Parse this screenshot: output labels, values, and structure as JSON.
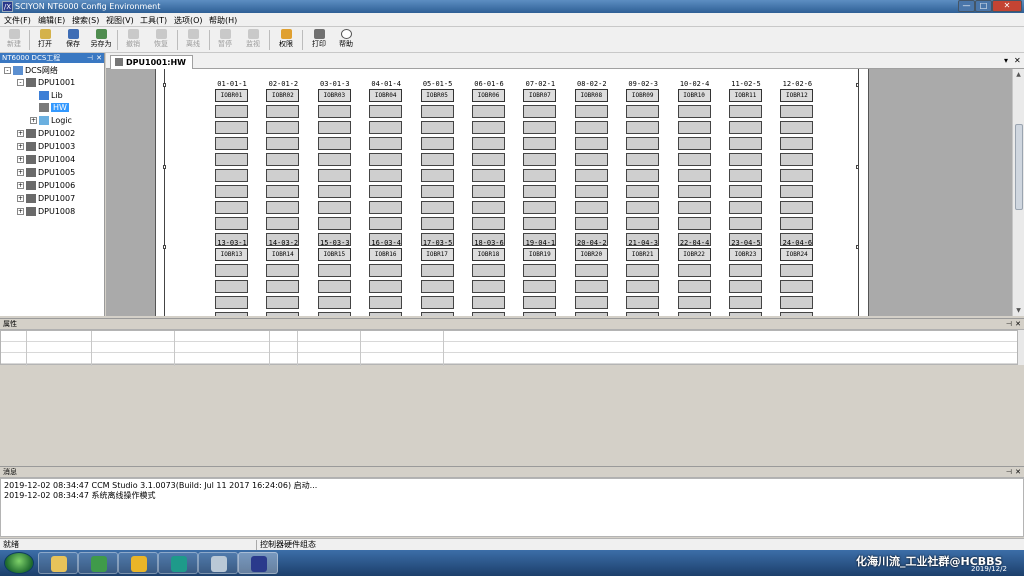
{
  "window": {
    "app_icon": "/X",
    "title": "SCIYON NT6000 Config Environment",
    "min_glyph": "—",
    "max_glyph": "□",
    "close_glyph": "✕"
  },
  "menu": [
    "文件(F)",
    "编辑(E)",
    "搜索(S)",
    "视图(V)",
    "工具(T)",
    "选项(O)",
    "帮助(H)"
  ],
  "toolbar": [
    {
      "label": "新建",
      "icon": "home-icon",
      "enabled": false
    },
    {
      "label": "打开",
      "icon": "open-icon",
      "enabled": true
    },
    {
      "label": "保存",
      "icon": "save-icon",
      "enabled": true
    },
    {
      "label": "另存为",
      "icon": "save-as-icon",
      "enabled": true
    },
    {
      "label": "撤销",
      "icon": "undo-icon",
      "enabled": false
    },
    {
      "label": "恢复",
      "icon": "redo-icon",
      "enabled": false
    },
    {
      "label": "离线",
      "icon": "offline-icon",
      "enabled": false
    },
    {
      "label": "暂停",
      "icon": "pause-icon",
      "enabled": false
    },
    {
      "label": "监视",
      "icon": "monitor-icon",
      "enabled": false
    },
    {
      "label": "权限",
      "icon": "permission-icon",
      "enabled": true
    },
    {
      "label": "打印",
      "icon": "print-icon",
      "enabled": true
    },
    {
      "label": "帮助",
      "icon": "help-icon",
      "enabled": true
    }
  ],
  "tree": {
    "title": "NT6000 DCS工程",
    "pin_glyph": "⊣",
    "close_glyph": "✕",
    "nodes": [
      {
        "label": "DCS网络",
        "icon": "network-icon",
        "expander": "-"
      },
      {
        "label": "DPU1001",
        "icon": "dpu-icon",
        "expander": "-"
      },
      {
        "label": "Lib",
        "icon": "library-icon",
        "expander": ""
      },
      {
        "label": "HW",
        "icon": "hardware-icon",
        "expander": "",
        "selected": true
      },
      {
        "label": "Logic",
        "icon": "logic-icon",
        "expander": "+"
      },
      {
        "label": "DPU1002",
        "icon": "dpu-icon",
        "expander": "+"
      },
      {
        "label": "DPU1003",
        "icon": "dpu-icon",
        "expander": "+"
      },
      {
        "label": "DPU1004",
        "icon": "dpu-icon",
        "expander": "+"
      },
      {
        "label": "DPU1005",
        "icon": "dpu-icon",
        "expander": "+"
      },
      {
        "label": "DPU1006",
        "icon": "dpu-icon",
        "expander": "+"
      },
      {
        "label": "DPU1007",
        "icon": "dpu-icon",
        "expander": "+"
      },
      {
        "label": "DPU1008",
        "icon": "dpu-icon",
        "expander": "+"
      }
    ]
  },
  "document_tab": {
    "label": "DPU1001:HW",
    "menu_glyph": "▾",
    "close_glyph": "✕"
  },
  "racks": {
    "row1": [
      {
        "code": "01-01-1",
        "name": "IOBR01"
      },
      {
        "code": "02-01-2",
        "name": "IOBR02"
      },
      {
        "code": "03-01-3",
        "name": "IOBR03"
      },
      {
        "code": "04-01-4",
        "name": "IOBR04"
      },
      {
        "code": "05-01-5",
        "name": "IOBR05"
      },
      {
        "code": "06-01-6",
        "name": "IOBR06"
      },
      {
        "code": "07-02-1",
        "name": "IOBR07"
      },
      {
        "code": "08-02-2",
        "name": "IOBR08"
      },
      {
        "code": "09-02-3",
        "name": "IOBR09"
      },
      {
        "code": "10-02-4",
        "name": "IOBR10"
      },
      {
        "code": "11-02-5",
        "name": "IOBR11"
      },
      {
        "code": "12-02-6",
        "name": "IOBR12"
      }
    ],
    "row2": [
      {
        "code": "13-03-1",
        "name": "IOBR13"
      },
      {
        "code": "14-03-2",
        "name": "IOBR14"
      },
      {
        "code": "15-03-3",
        "name": "IOBR15"
      },
      {
        "code": "16-03-4",
        "name": "IOBR16"
      },
      {
        "code": "17-03-5",
        "name": "IOBR17"
      },
      {
        "code": "18-03-6",
        "name": "IOBR18"
      },
      {
        "code": "19-04-1",
        "name": "IOBR19"
      },
      {
        "code": "20-04-2",
        "name": "IOBR20"
      },
      {
        "code": "21-04-3",
        "name": "IOBR21"
      },
      {
        "code": "22-04-4",
        "name": "IOBR22"
      },
      {
        "code": "23-04-5",
        "name": "IOBR23"
      },
      {
        "code": "24-04-6",
        "name": "IOBR24"
      }
    ]
  },
  "scrollbar": {
    "up_glyph": "▲",
    "down_glyph": "▼"
  },
  "properties": {
    "title": "属性",
    "pin_glyph": "⊣",
    "close_glyph": "✕"
  },
  "messages": {
    "title": "消息",
    "pin_glyph": "⊣",
    "close_glyph": "✕",
    "lines": [
      "2019-12-02 08:34:47 CCM Studio 3.1.0073(Build: Jul 11 2017 16:24:06) 启动...",
      "2019-12-02 08:34:47 系统离线操作模式"
    ]
  },
  "status": {
    "left": "就绪",
    "middle": "控制器硬件组态"
  },
  "taskbar": {
    "watermark": "化海川流_工业社群@HCBBS",
    "date": "2019/12/2",
    "items": [
      {
        "icon": "file-explorer-icon",
        "color": "#e8c35a"
      },
      {
        "icon": "box-app-icon",
        "color": "#3f9a4a"
      },
      {
        "icon": "database-icon",
        "color": "#e9b528"
      },
      {
        "icon": "refresh-app-icon",
        "color": "#1e9a8a"
      },
      {
        "icon": "tools-app-icon",
        "color": "#b9c8d6"
      },
      {
        "icon": "sciyon-app-icon",
        "color": "#2a3a8c",
        "active": true
      }
    ]
  }
}
